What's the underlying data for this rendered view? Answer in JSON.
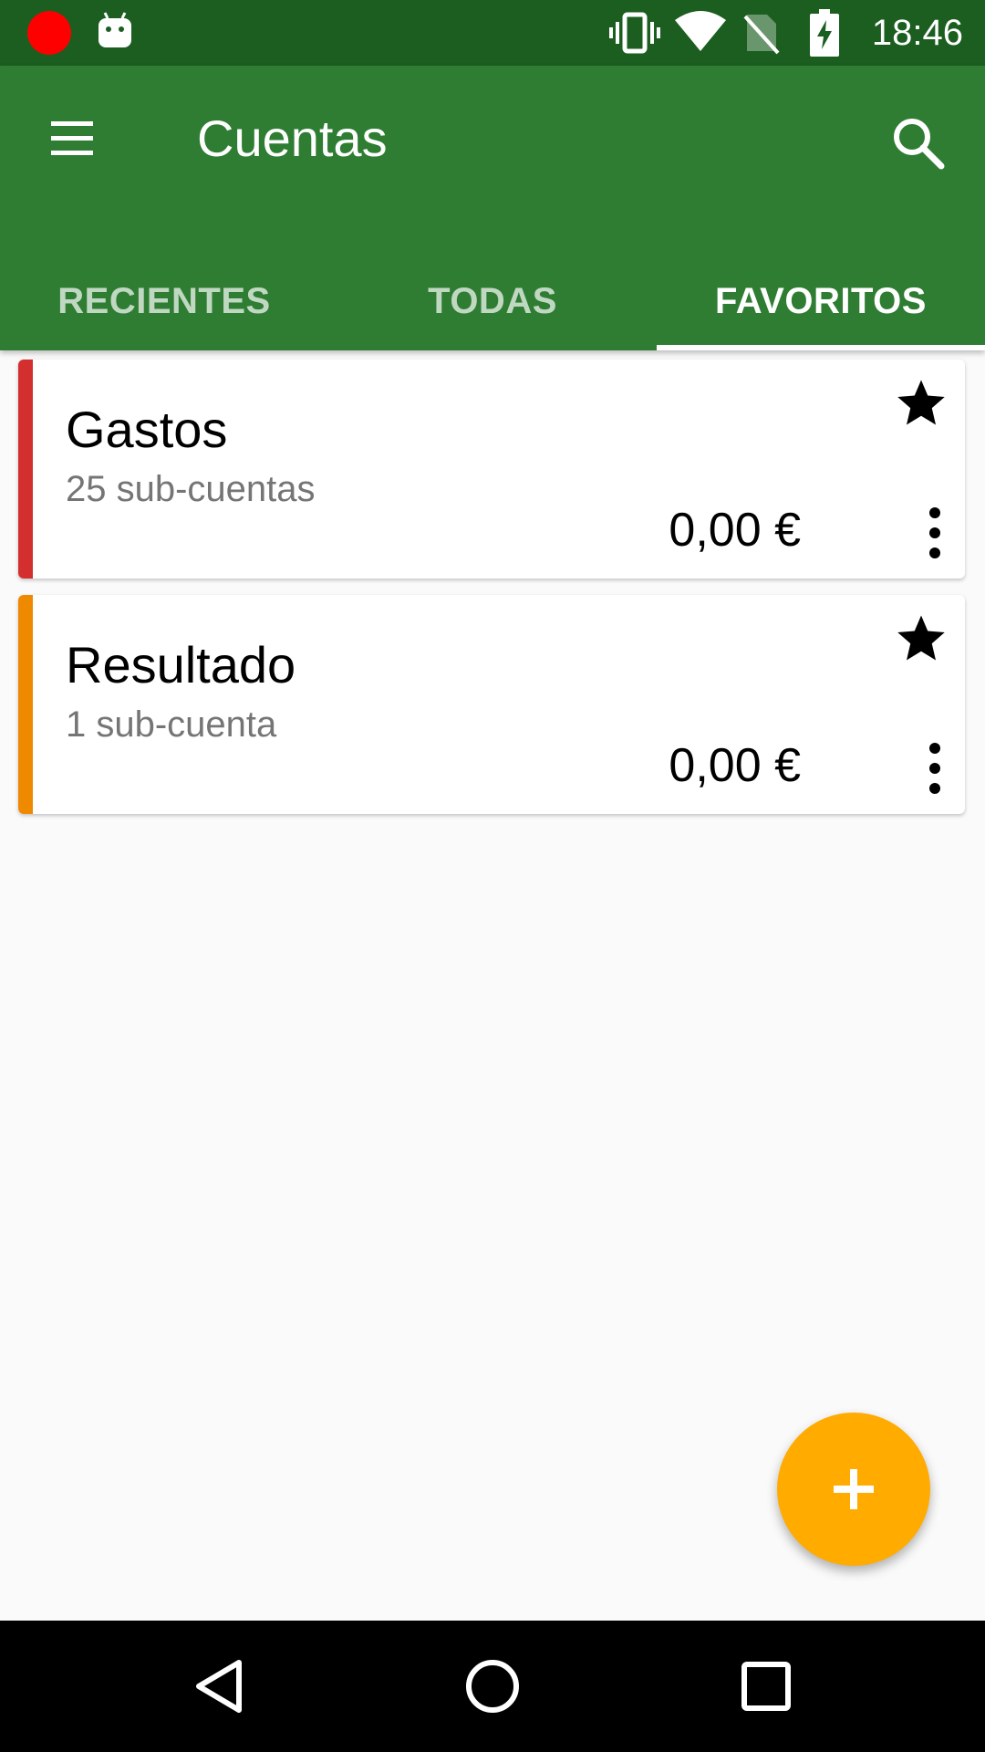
{
  "status_bar": {
    "time": "18:46",
    "icons": [
      "recording-dot-icon",
      "android-icon",
      "vibrate-icon",
      "wifi-icon",
      "no-sim-icon",
      "battery-charging-icon"
    ]
  },
  "app_bar": {
    "title": "Cuentas",
    "menu_icon": "menu-icon",
    "search_icon": "search-icon"
  },
  "tabs": [
    {
      "label": "RECIENTES",
      "selected": false
    },
    {
      "label": "TODAS",
      "selected": false
    },
    {
      "label": "FAVORITOS",
      "selected": true
    }
  ],
  "accounts": [
    {
      "name": "Gastos",
      "subaccounts": "25 sub-cuentas",
      "balance": "0,00 €",
      "color": "#d32f2f",
      "favorite": true
    },
    {
      "name": "Resultado",
      "subaccounts": "1 sub-cuenta",
      "balance": "0,00 €",
      "color": "#ef8a00",
      "favorite": true
    }
  ],
  "fab": {
    "icon": "plus-icon",
    "color": "#ffab00"
  },
  "nav_bar": {
    "icons": [
      "back-icon",
      "home-icon",
      "recents-icon"
    ]
  },
  "colors": {
    "status_bar": "#1b5e20",
    "app_bar": "#2e7d32",
    "background": "#fafafa"
  }
}
